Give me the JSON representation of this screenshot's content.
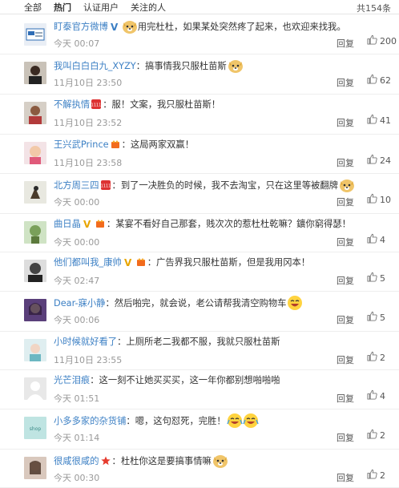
{
  "tabs": [
    {
      "label": "全部"
    },
    {
      "label": "热门",
      "active": true
    },
    {
      "label": "认证用户"
    },
    {
      "label": "关注的人"
    }
  ],
  "total": "共154条",
  "reply_label": "回复",
  "colors": {
    "link": "#3b7fc4",
    "time": "#999999"
  },
  "comments": [
    {
      "user": "盯泰官方微博",
      "badge": "verified-blue",
      "text": "用完杜杜，如果某处突然疼了起来，也欢迎来找我。",
      "emoji_before": true,
      "time": "今天 00:07",
      "likes": "200",
      "avatar": "brand-logo"
    },
    {
      "user": "我叫白白白九_XYZY",
      "text": "搞事情我只服杜苗斯",
      "emoji_after": "doge",
      "time": "11月10日 23:50",
      "likes": "62",
      "avatar": "person-dark"
    },
    {
      "user": "不解执情",
      "badge": "level-1111",
      "text": "服！文案，我只服杜苗斯！",
      "time": "11月10日 23:52",
      "likes": "41",
      "avatar": "person-red"
    },
    {
      "user": "王兴武Prince",
      "badge": "vip-crown",
      "text": "这局两家双赢！",
      "time": "11月10日 23:58",
      "likes": "24",
      "avatar": "child"
    },
    {
      "user": "北方周三四",
      "badge": "level-1111",
      "text": "到了一决胜负的时候，我不去淘宝，只在这里等被翻牌",
      "emoji_after": "doge",
      "time": "今天 00:00",
      "likes": "10",
      "avatar": "bird"
    },
    {
      "user": "曲日晶",
      "badge": "verified-gold",
      "badge2": "vip-crown",
      "text": "某宴不看好自己那套，贱次次的惹杜杜乾嘛？鑛你窮得瑟！",
      "time": "今天 00:00",
      "likes": "4",
      "avatar": "cartoon"
    },
    {
      "user": "他们都叫我_康帅",
      "badge": "verified-gold",
      "badge2": "vip-crown",
      "text": "广告界我只服杜苗斯，但是我用冈本！",
      "time": "今天 02:47",
      "likes": "5",
      "avatar": "portrait-bw"
    },
    {
      "user": "Dear-寐小静",
      "text": "然后啪完，就会说，老公请帮我清空购物车",
      "emoji_after": "laugh",
      "time": "今天 00:06",
      "likes": "5",
      "avatar": "girl-purple"
    },
    {
      "user": "小时候就好看了",
      "text": "上厕所老二我都不服，我就只服杜苗斯",
      "time": "11月10日 23:55",
      "likes": "2",
      "avatar": "girl-teal"
    },
    {
      "user": "光芒泪痕",
      "text": "这一刻不让她买买买，这一年你都别想啪啪啪",
      "time": "今天 01:51",
      "likes": "4",
      "avatar": "default"
    },
    {
      "user": "小多多家的杂货铺",
      "text": "嗯，这句怼死，完胜！",
      "emoji_after": "cry2",
      "time": "今天 01:14",
      "likes": "2",
      "avatar": "shop"
    },
    {
      "user": "很咸很咸的",
      "badge": "star-red",
      "text": "杜杜你这是要搞事情嘛",
      "emoji_after": "doge",
      "time": "今天 00:30",
      "likes": "2",
      "avatar": "woman"
    }
  ]
}
